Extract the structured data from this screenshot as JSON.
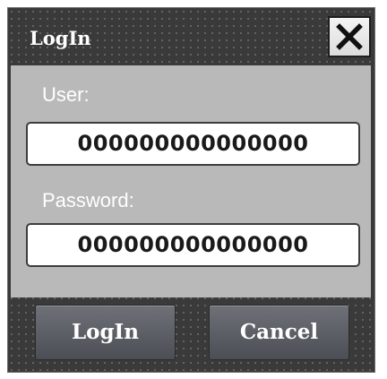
{
  "dialog": {
    "title": "LogIn",
    "close_icon": "close-x-icon"
  },
  "fields": {
    "user_label": "User:",
    "user_value": "000000000000000",
    "password_label": "Password:",
    "password_value": "000000000000000"
  },
  "buttons": {
    "login_label": "LogIn",
    "cancel_label": "Cancel"
  },
  "colors": {
    "frame": "#3a3a3a",
    "content_panel": "#b9b9b9",
    "button": "#5a5e64"
  }
}
